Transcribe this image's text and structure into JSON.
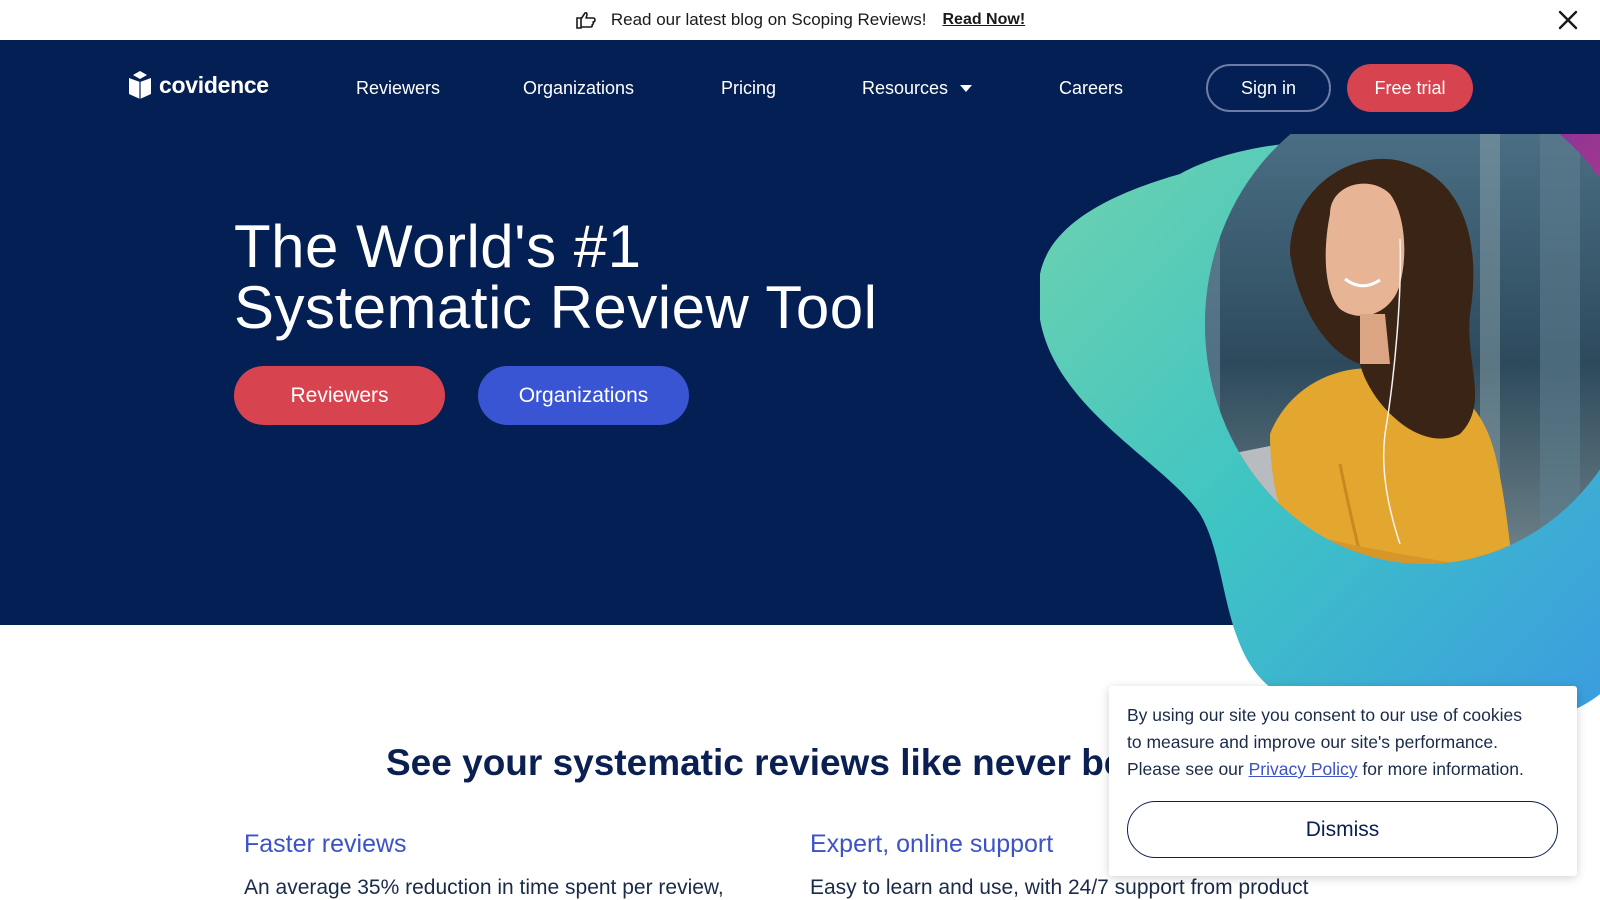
{
  "announcement": {
    "text": "Read our latest blog on Scoping Reviews!",
    "link": "Read Now!",
    "icon": "pointing-hand-icon",
    "close_icon": "close-icon"
  },
  "nav": {
    "brand": "covidence",
    "items": [
      "Reviewers",
      "Organizations",
      "Pricing",
      "Resources",
      "Careers"
    ],
    "sign_in": "Sign in",
    "free_trial": "Free trial"
  },
  "hero": {
    "title_line1": "The World's #1",
    "title_line2": "Systematic Review Tool",
    "buttons": [
      "Reviewers",
      "Organizations"
    ]
  },
  "features": {
    "heading": "See your systematic reviews like never before",
    "items": [
      {
        "title": "Faster reviews",
        "text": "An average 35% reduction in time spent per review,"
      },
      {
        "title": "Expert, online support",
        "text": "Easy to learn and use, with 24/7 support from product"
      }
    ]
  },
  "cookie": {
    "line1": "By using our site you consent to our use of cookies",
    "line2": "to measure and improve our site's performance.",
    "line3_before": "Please see our ",
    "link": "Privacy Policy",
    "line3_after": " for more information.",
    "dismiss": "Dismiss"
  },
  "colors": {
    "navy": "#041f54",
    "accent_red": "#d7434f",
    "accent_blue": "#3a55d4",
    "link_blue": "#3c52c8"
  }
}
